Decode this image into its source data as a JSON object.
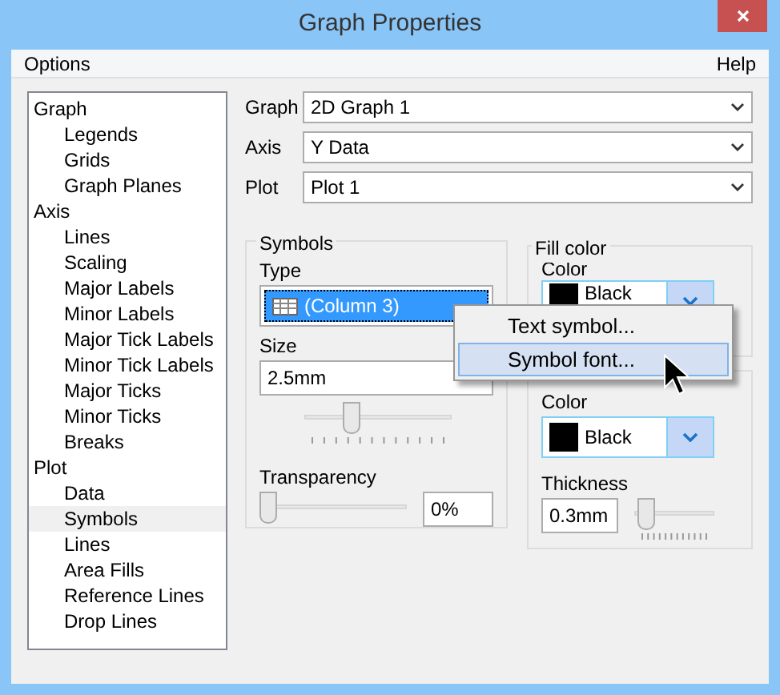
{
  "window": {
    "title": "Graph Properties"
  },
  "menu": [
    {
      "label": "Options"
    },
    {
      "label": "Help"
    }
  ],
  "tree": [
    {
      "label": "Graph",
      "selected": false,
      "children": [
        {
          "label": "Legends",
          "selected": false
        },
        {
          "label": "Grids",
          "selected": false
        },
        {
          "label": "Graph Planes",
          "selected": false
        }
      ]
    },
    {
      "label": "Axis",
      "selected": false,
      "children": [
        {
          "label": "Lines",
          "selected": false
        },
        {
          "label": "Scaling",
          "selected": false
        },
        {
          "label": "Major Labels",
          "selected": false
        },
        {
          "label": "Minor Labels",
          "selected": false
        },
        {
          "label": "Major Tick Labels",
          "selected": false
        },
        {
          "label": "Minor Tick Labels",
          "selected": false
        },
        {
          "label": "Major Ticks",
          "selected": false
        },
        {
          "label": "Minor Ticks",
          "selected": false
        },
        {
          "label": "Breaks",
          "selected": false
        }
      ]
    },
    {
      "label": "Plot",
      "selected": false,
      "children": [
        {
          "label": "Data",
          "selected": false
        },
        {
          "label": "Symbols",
          "selected": true
        },
        {
          "label": "Lines",
          "selected": false
        },
        {
          "label": "Area Fills",
          "selected": false
        },
        {
          "label": "Reference Lines",
          "selected": false
        },
        {
          "label": "Drop Lines",
          "selected": false
        }
      ]
    }
  ],
  "selectors": [
    {
      "label": "Graph",
      "value": "2D Graph 1"
    },
    {
      "label": "Axis",
      "value": "Y Data"
    },
    {
      "label": "Plot",
      "value": "Plot 1"
    }
  ],
  "symbols": {
    "title": "Symbols",
    "type_label": "Type",
    "type_value": "(Column 3)",
    "size_label": "Size",
    "size_value": "2.5mm",
    "size_slider": {
      "level": 0.3
    },
    "transparency_label": "Transparency",
    "transparency_slider": {
      "level": 0
    },
    "transparency_value": "0%"
  },
  "fill_color": {
    "title": "Fill color",
    "color_label": "Color",
    "color_value": "Black",
    "color": "#000000"
  },
  "line": {
    "color_label": "Color",
    "color_value": "Black",
    "color": "#000000",
    "thickness_label": "Thickness",
    "thickness_value": "0.3mm",
    "thickness_slider": {
      "level": 0.05
    }
  },
  "popup_menu": [
    {
      "label": "Text symbol...",
      "selected": false
    },
    {
      "label": "Symbol font...",
      "selected": true
    }
  ]
}
